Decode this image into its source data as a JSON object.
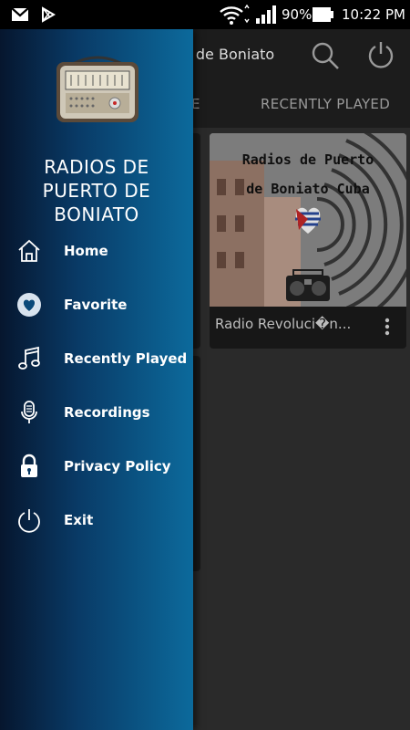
{
  "status_bar": {
    "battery": "90%",
    "time": "10:22 PM",
    "icons": [
      "gmail-icon",
      "play-store-icon",
      "wifi-icon",
      "signal-icon",
      "battery-icon"
    ]
  },
  "app_bar": {
    "title_partial": "o de Boniato",
    "icons": [
      "search-icon",
      "power-icon"
    ]
  },
  "tabs": [
    "E",
    "RECENTLY PLAYED"
  ],
  "station_card": {
    "artwork_text_line1": "Radios de Puerto",
    "artwork_text_line2": "de Boniato Cuba",
    "name": "Radio Revoluci�n..."
  },
  "drawer": {
    "title_lines": [
      "RADIOS DE",
      "PUERTO DE",
      "BONIATO"
    ],
    "menu": [
      {
        "label": "Home",
        "icon": "home-icon"
      },
      {
        "label": "Favorite",
        "icon": "heart-icon"
      },
      {
        "label": "Recently Played",
        "icon": "music-note-icon"
      },
      {
        "label": "Recordings",
        "icon": "microphone-icon"
      },
      {
        "label": "Privacy Policy",
        "icon": "lock-icon"
      },
      {
        "label": "Exit",
        "icon": "power-icon"
      }
    ]
  },
  "colors": {
    "drawer_dark": "#06162e",
    "drawer_light": "#0c6a9c",
    "background": "#2a2a2a"
  }
}
